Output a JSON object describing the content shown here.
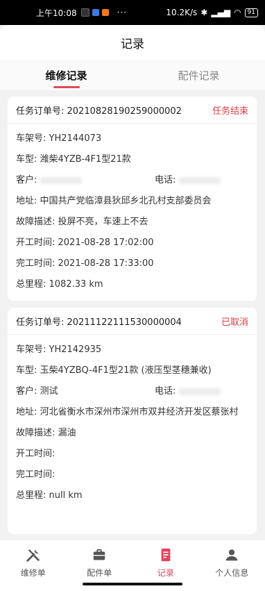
{
  "status_bar": {
    "time": "上午10:08",
    "dots": "···",
    "net_speed": "10.2K/s",
    "battery": "91"
  },
  "header": {
    "title": "记录"
  },
  "tabs": [
    {
      "label": "维修记录",
      "active": true
    },
    {
      "label": "配件记录",
      "active": false
    }
  ],
  "records": [
    {
      "order_label": "任务订单号: 20210828190259000002",
      "status": "任务结束",
      "frame": "车架号: YH2144073",
      "model": "车型: 潍柴4YZB-4F1型21款",
      "customer": "客户:",
      "phone": "电话:",
      "address": "地址: 中国共产党临漳县狄邱乡北孔村支部委员会",
      "fault": "故障描述: 投屏不亮，车速上不去",
      "start": "开工时间: 2021-08-28 17:02:00",
      "finish": "完工时间: 2021-08-28 17:33:00",
      "mileage": "总里程: 1082.33 km"
    },
    {
      "order_label": "任务订单号: 20211122111530000004",
      "status": "已取消",
      "frame": "车架号: YH2142935",
      "model": "车型: 玉柴4YZBQ-4F1型21款 (液压型茎穗兼收)",
      "customer": "客户: 测试",
      "phone": "电话:",
      "address": "地址: 河北省衡水市深州市深州市双井经济开发区蔡张村",
      "fault": "故障描述: 漏油",
      "start": "开工时间:",
      "finish": "完工时间:",
      "mileage": "总里程: null km"
    }
  ],
  "bottom_nav": [
    {
      "label": "维修单",
      "icon": "tools-icon",
      "active": false
    },
    {
      "label": "配件单",
      "icon": "briefcase-icon",
      "active": false
    },
    {
      "label": "记录",
      "icon": "document-icon",
      "active": true
    },
    {
      "label": "个人信息",
      "icon": "person-icon",
      "active": false
    }
  ],
  "colors": {
    "accent": "#e0455a",
    "status_red": "#e03b45"
  }
}
